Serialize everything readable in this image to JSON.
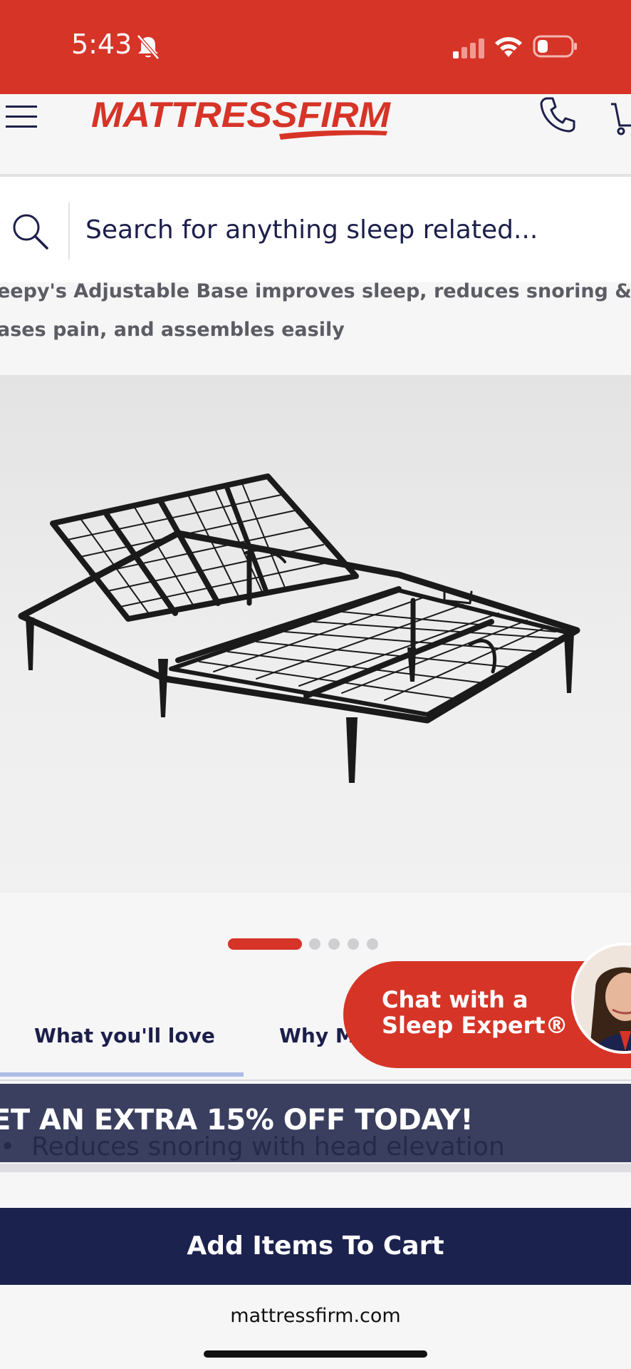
{
  "status_bar": {
    "time": "5:43",
    "icons": [
      "bell-slash-icon",
      "signal-icon",
      "wifi-icon",
      "battery-icon"
    ],
    "background_color": "#d63427"
  },
  "header": {
    "logo_text": "MATTRESSFIRM",
    "icons": [
      "hamburger-menu-icon",
      "phone-icon",
      "cart-icon"
    ],
    "brand_color": "#d63427"
  },
  "search": {
    "placeholder": "Search for anything sleep related..."
  },
  "product": {
    "description_line1": "eepy's Adjustable Base improves sleep, reduces snoring & refr",
    "description_line2": "ases pain, and assembles easily",
    "carousel": {
      "total": 5,
      "active": 1
    }
  },
  "tabs": [
    {
      "label": "What you'll love",
      "active": true
    },
    {
      "label": "Why M",
      "active": false
    }
  ],
  "chat": {
    "label": "Chat with a\nSleep Expert®"
  },
  "promo": {
    "banner_text": "ET AN EXTRA 15% OFF TODAY!",
    "bullet_text": "Reduces snoring with head elevation"
  },
  "cart": {
    "button_label": "Add Items To Cart",
    "button_color": "#1c224e"
  },
  "footer": {
    "url": "mattressfirm.com"
  }
}
